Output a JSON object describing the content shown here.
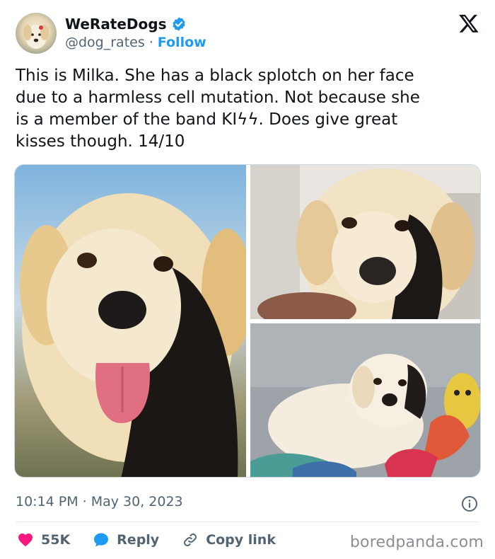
{
  "account": {
    "name": "WeRateDogs",
    "handle": "@dog_rates",
    "separator": "·",
    "follow_label": "Follow"
  },
  "tweet": {
    "text": "This is Milka. She has a black splotch on her face\ndue to a harmless cell mutation. Not because she\nis a member of the band KIϟϟ. Does give great\nkisses though. 14/10",
    "time": "10:14 PM",
    "separator": "·",
    "date": "May 30, 2023"
  },
  "actions": {
    "likes": "55K",
    "reply_label": "Reply",
    "copy_link_label": "Copy link"
  },
  "watermark": "boredpanda.com",
  "colors": {
    "accent_blue": "#1d9bf0",
    "like_red": "#f91880",
    "text_primary": "#0f1419",
    "text_secondary": "#536471"
  },
  "icons": {
    "platform": "x-logo-icon",
    "verified": "verified-badge-icon",
    "info": "info-icon",
    "like": "heart-icon",
    "reply": "reply-bubble-icon",
    "copy": "link-icon"
  }
}
